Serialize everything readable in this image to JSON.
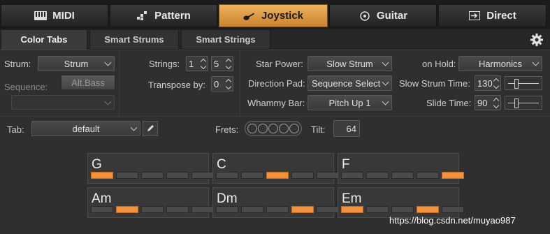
{
  "top_tabs": [
    {
      "label": "MIDI",
      "icon": "piano-keys-icon"
    },
    {
      "label": "Pattern",
      "icon": "pattern-grid-icon"
    },
    {
      "label": "Joystick",
      "icon": "guitar-icon",
      "active": true
    },
    {
      "label": "Guitar",
      "icon": "guitar-pick-icon"
    },
    {
      "label": "Direct",
      "icon": "direct-arrow-icon"
    }
  ],
  "sub_tabs": [
    {
      "label": "Color Tabs",
      "active": true
    },
    {
      "label": "Smart Strums"
    },
    {
      "label": "Smart Strings"
    }
  ],
  "settings_icon": "gear-icon",
  "left": {
    "strum_label": "Strum:",
    "strum_value": "Strum",
    "sequence_label": "Sequence:",
    "altbass_label": "Alt.Bass",
    "sequence_value": ""
  },
  "middle": {
    "strings_label": "Strings:",
    "strings_from": "1",
    "strings_to": "5",
    "transpose_label": "Transpose by:",
    "transpose_value": "0"
  },
  "right": {
    "star_power_label": "Star Power:",
    "star_power_value": "Slow Strum",
    "direction_pad_label": "Direction Pad:",
    "direction_pad_value": "Sequence Select",
    "whammy_bar_label": "Whammy Bar:",
    "whammy_bar_value": "Pitch Up 1",
    "on_hold_label": "on Hold:",
    "on_hold_value": "Harmonics",
    "slow_strum_time_label": "Slow Strum Time:",
    "slow_strum_time_value": "130",
    "slide_time_label": "Slide Time:",
    "slide_time_value": "90",
    "slow_strum_slider_level": 0.2,
    "slide_slider_level": 0.2
  },
  "tab_row": {
    "tab_label": "Tab:",
    "tab_value": "default",
    "frets_label": "Frets:",
    "tilt_label": "Tilt:",
    "tilt_value": "64"
  },
  "chords": [
    {
      "name": "G",
      "active": [
        0
      ]
    },
    {
      "name": "C",
      "active": [
        2
      ]
    },
    {
      "name": "F",
      "active": [
        4
      ]
    },
    {
      "name": "Am",
      "active": [
        1
      ]
    },
    {
      "name": "Dm",
      "active": [
        3
      ]
    },
    {
      "name": "Em",
      "active": [
        0,
        3
      ]
    }
  ],
  "colors": {
    "accent": "#e69a45",
    "fret_on": "#f2913e",
    "background": "#2b2b2b"
  },
  "watermark": "https://blog.csdn.net/muyao987"
}
